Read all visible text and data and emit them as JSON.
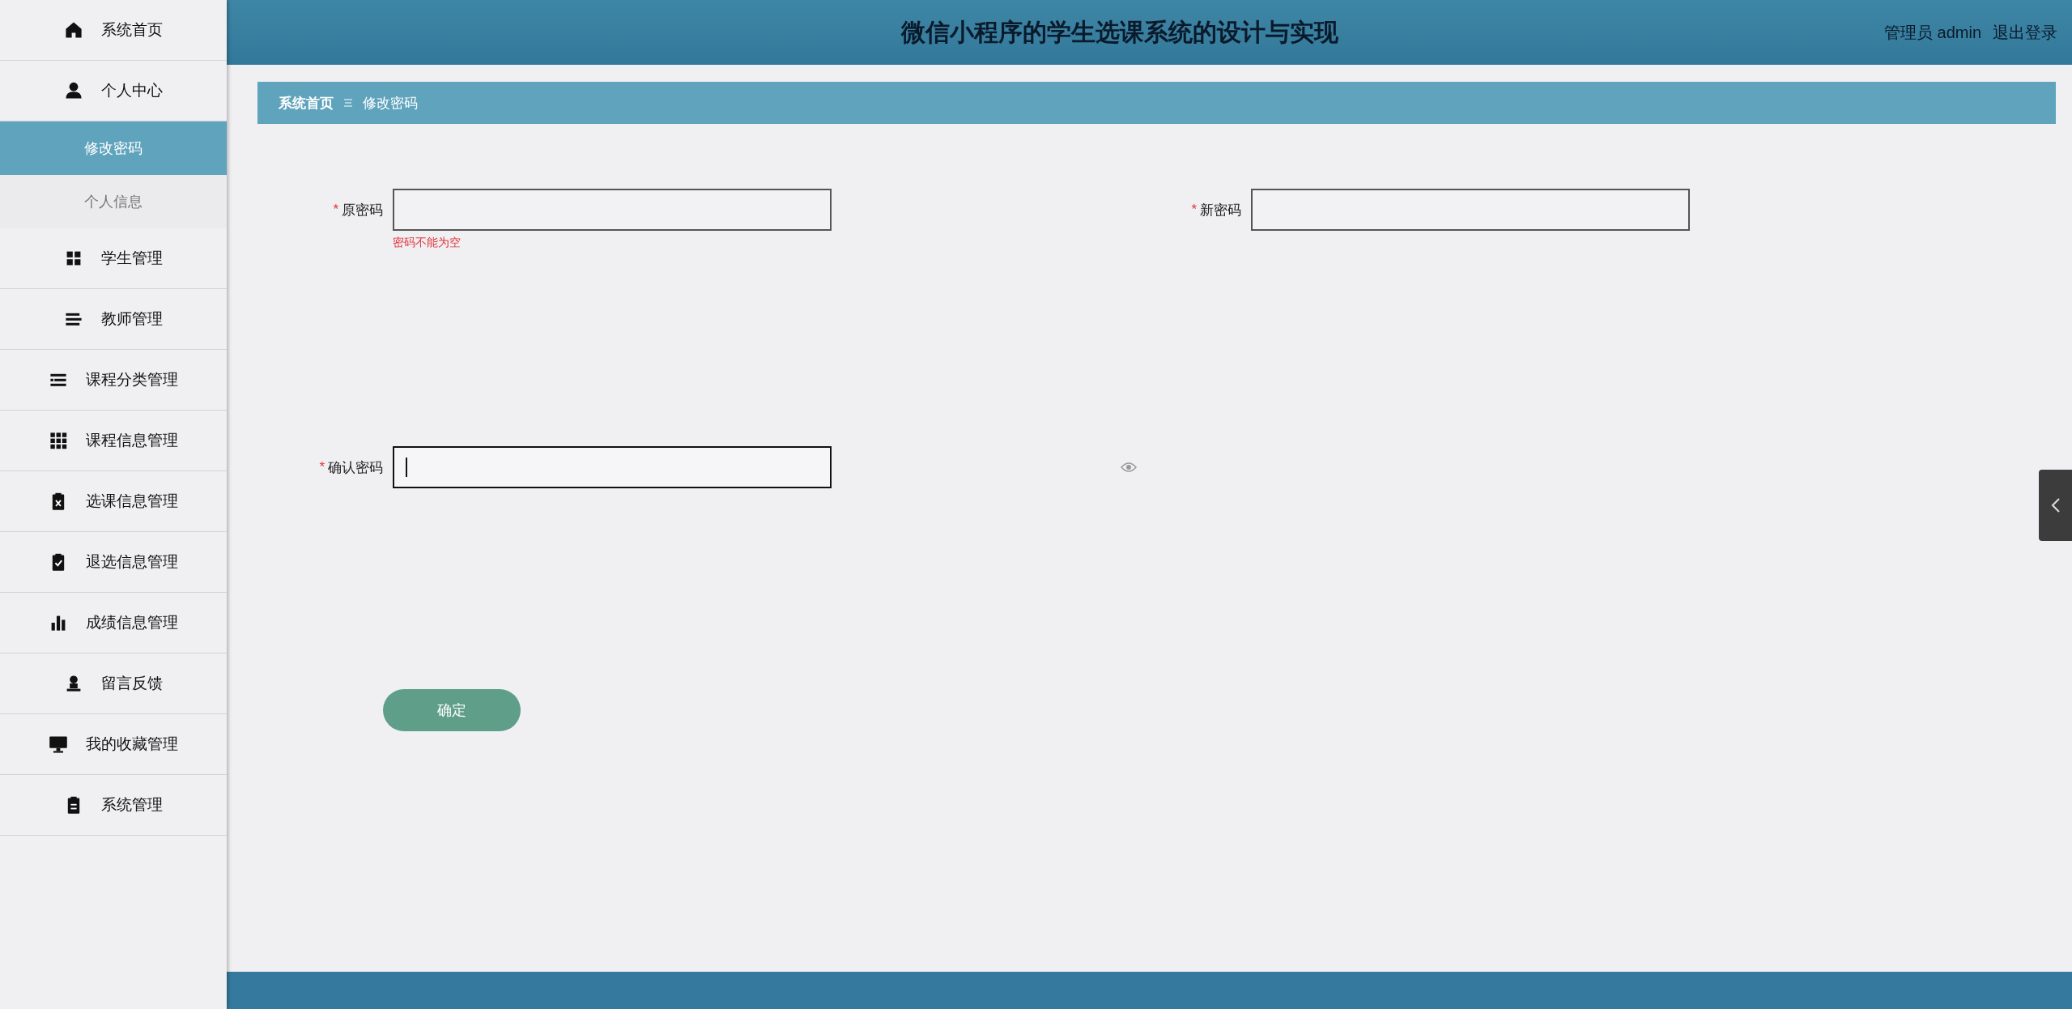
{
  "sidebar": {
    "items": [
      {
        "label": "系统首页",
        "selected": false
      },
      {
        "label": "个人中心",
        "selected": false,
        "expanded": true,
        "children": [
          {
            "label": "修改密码",
            "selected": true
          },
          {
            "label": "个人信息",
            "selected": false
          }
        ]
      },
      {
        "label": "学生管理",
        "selected": false
      },
      {
        "label": "教师管理",
        "selected": false
      },
      {
        "label": "课程分类管理",
        "selected": false
      },
      {
        "label": "课程信息管理",
        "selected": false
      },
      {
        "label": "选课信息管理",
        "selected": false
      },
      {
        "label": "退选信息管理",
        "selected": false
      },
      {
        "label": "成绩信息管理",
        "selected": false
      },
      {
        "label": "留言反馈",
        "selected": false
      },
      {
        "label": "我的收藏管理",
        "selected": false
      },
      {
        "label": "系统管理",
        "selected": false
      }
    ]
  },
  "header": {
    "title": "微信小程序的学生选课系统的设计与实现",
    "user": "管理员 admin",
    "logout": "退出登录"
  },
  "breadcrumb": [
    "系统首页",
    "修改密码"
  ],
  "form": {
    "fields": [
      {
        "label": "原密码",
        "required_mark": "*",
        "error": "密码不能为空",
        "focused": false
      },
      {
        "label": "新密码",
        "required_mark": "*",
        "focused": false
      },
      {
        "label": "确认密码",
        "required_mark": "*",
        "focused": true
      }
    ],
    "submit": "确定"
  }
}
